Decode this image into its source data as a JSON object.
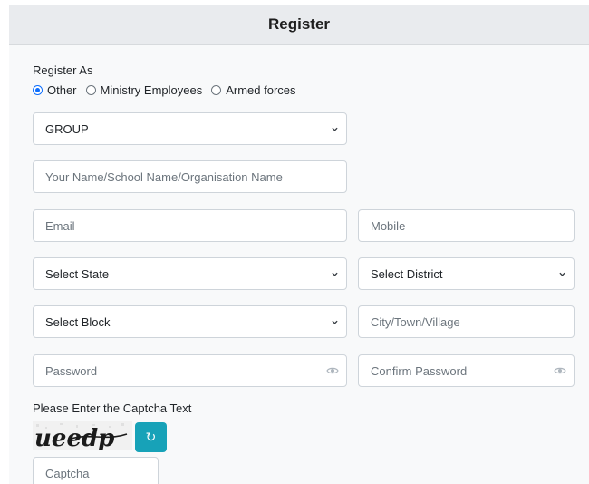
{
  "header": {
    "title": "Register"
  },
  "register_as": {
    "label": "Register As",
    "options": [
      {
        "label": "Other",
        "checked": true
      },
      {
        "label": "Ministry Employees",
        "checked": false
      },
      {
        "label": "Armed forces",
        "checked": false
      }
    ]
  },
  "form": {
    "group_select": "GROUP",
    "name_placeholder": "Your Name/School Name/Organisation Name",
    "email_placeholder": "Email",
    "mobile_placeholder": "Mobile",
    "state_select": "Select State",
    "district_select": "Select District",
    "block_select": "Select Block",
    "city_placeholder": "City/Town/Village",
    "password_placeholder": "Password",
    "confirm_password_placeholder": "Confirm Password"
  },
  "captcha": {
    "label": "Please Enter the Captcha Text",
    "image_text": "ueedp",
    "refresh_icon": "↻",
    "input_placeholder": "Captcha"
  },
  "colors": {
    "accent": "#0d6efd",
    "refresh_button": "#17a2b8",
    "header_bg": "#e9ebee"
  },
  "icons": {
    "select": "chevron-down-icon",
    "password": "eye-icon",
    "refresh": "refresh-icon"
  }
}
